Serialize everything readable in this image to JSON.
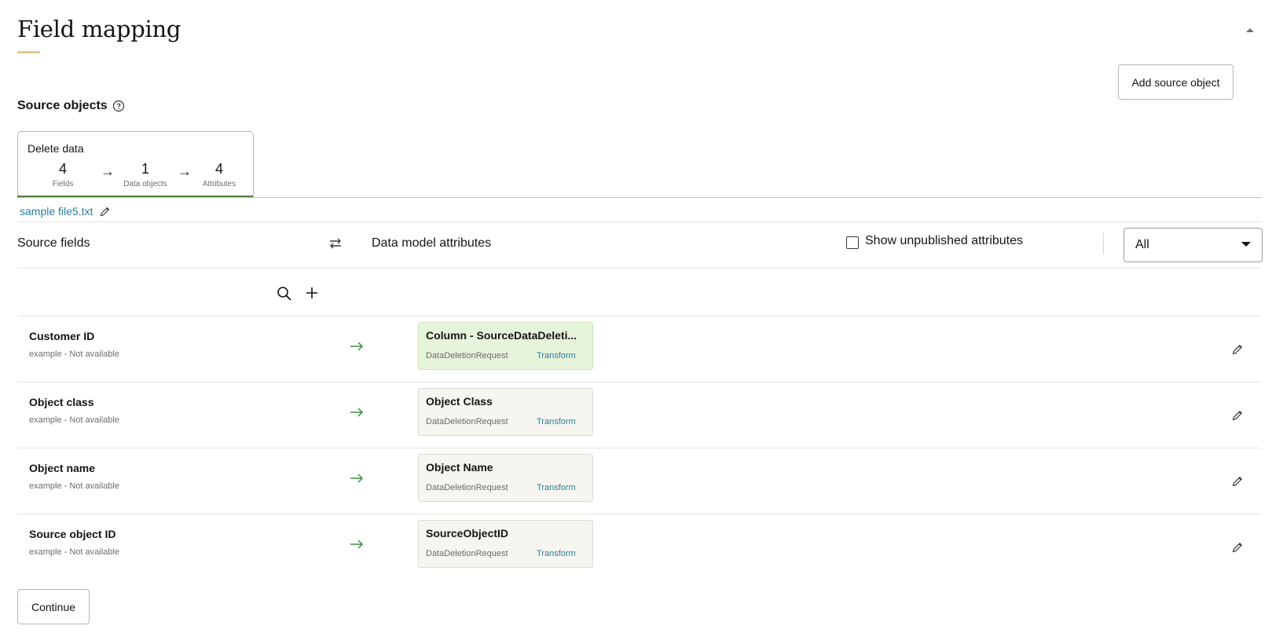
{
  "header": {
    "title": "Field mapping",
    "add_source_label": "Add source object"
  },
  "source_objects": {
    "title": "Source objects",
    "card": {
      "title": "Delete data",
      "fields_count": "4",
      "fields_label": "Fields",
      "data_objects_count": "1",
      "data_objects_label": "Data objects",
      "attributes_count": "4",
      "attributes_label": "Attributes"
    },
    "file_name": "sample file5.txt"
  },
  "mapping_header": {
    "source_fields": "Source fields",
    "data_model_attributes": "Data model attributes",
    "show_unpublished_label": "Show unpublished attributes",
    "show_unpublished_checked": false,
    "filter_value": "All"
  },
  "rows": [
    {
      "name": "Customer ID",
      "example": "example - Not available",
      "attribute": "Column - SourceDataDeleti...",
      "object": "DataDeletionRequest",
      "transform": "Transform",
      "mapped": true
    },
    {
      "name": "Object class",
      "example": "example - Not available",
      "attribute": "Object Class",
      "object": "DataDeletionRequest",
      "transform": "Transform",
      "mapped": false
    },
    {
      "name": "Object name",
      "example": "example - Not available",
      "attribute": "Object Name",
      "object": "DataDeletionRequest",
      "transform": "Transform",
      "mapped": false
    },
    {
      "name": "Source object ID",
      "example": "example - Not available",
      "attribute": "SourceObjectID",
      "object": "DataDeletionRequest",
      "transform": "Transform",
      "mapped": false
    }
  ],
  "footer": {
    "continue_label": "Continue"
  },
  "colors": {
    "accent_underline": "#e7c789",
    "active_tab": "#4f7d3f",
    "link": "#2d7d9a",
    "arrow": "#3f8f4a",
    "mapped_bg": "#e6f4dc"
  }
}
